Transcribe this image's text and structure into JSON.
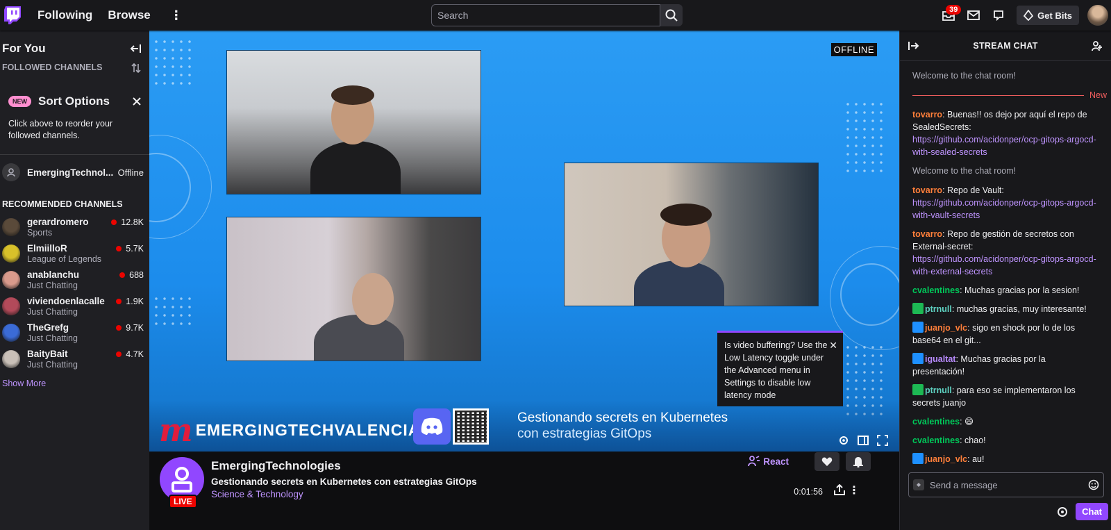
{
  "nav": {
    "following": "Following",
    "browse": "Browse",
    "search_placeholder": "Search",
    "notifications_count": "39",
    "get_bits": "Get Bits"
  },
  "sidebar": {
    "title": "For You",
    "followed_label": "FOLLOWED CHANNELS",
    "sort": {
      "badge": "NEW",
      "title": "Sort Options",
      "description": "Click above to reorder your followed channels."
    },
    "followed": [
      {
        "name": "EmergingTechnol...",
        "status": "Offline"
      }
    ],
    "recommended_label": "RECOMMENDED CHANNELS",
    "recommended": [
      {
        "name": "gerardromero",
        "category": "Sports",
        "viewers": "12.8K",
        "color": "#5a4a3a"
      },
      {
        "name": "ElmiilloR",
        "category": "League of Legends",
        "viewers": "5.7K",
        "color": "#d8c12a"
      },
      {
        "name": "anablanchu",
        "category": "Just Chatting",
        "viewers": "688",
        "color": "#d99a8c"
      },
      {
        "name": "viviendoenlacalle",
        "category": "Just Chatting",
        "viewers": "1.9K",
        "color": "#b34a5a"
      },
      {
        "name": "TheGrefg",
        "category": "Just Chatting",
        "viewers": "9.7K",
        "color": "#3b6bd6"
      },
      {
        "name": "BaityBait",
        "category": "Just Chatting",
        "viewers": "4.7K",
        "color": "#c9c0b8"
      }
    ],
    "show_more": "Show More"
  },
  "player": {
    "offline": "OFFLINE",
    "brand": "EMERGINGTECHVALENCIA",
    "overlay_line1": "Gestionando secrets en Kubernetes",
    "overlay_line2": "con estrategias GitOps",
    "buffer_tip": "Is video buffering? Use the Low Latency toggle under the Advanced menu in Settings to disable low latency mode"
  },
  "channel": {
    "name": "EmergingTechnologies",
    "stream_title": "Gestionando secrets en Kubernetes con estrategias GitOps",
    "category": "Science & Technology",
    "live": "LIVE",
    "react": "React",
    "uptime": "0:01:56"
  },
  "chat": {
    "title": "STREAM CHAT",
    "welcome": "Welcome to the chat room!",
    "new_label": "New",
    "input_placeholder": "Send a message",
    "chat_button": "Chat",
    "messages": [
      {
        "user": "tovarro",
        "color": "#ff7f3a",
        "badge": "",
        "text": " Buenas!! os dejo por aquí el repo de SealedSecrets: ",
        "link": "https://github.com/acidonper/ocp-gitops-argocd-with-sealed-secrets"
      },
      {
        "system": "Welcome to the chat room!"
      },
      {
        "user": "tovarro",
        "color": "#ff7f3a",
        "badge": "",
        "text": " Repo de Vault: ",
        "link": "https://github.com/acidonper/ocp-gitops-argocd-with-vault-secrets"
      },
      {
        "user": "tovarro",
        "color": "#ff7f3a",
        "badge": "",
        "text": " Repo de gestión de secretos con External-secret: ",
        "link": "https://github.com/acidonper/ocp-gitops-argocd-with-external-secrets"
      },
      {
        "user": "cvalentines",
        "color": "#00c95a",
        "badge": "",
        "text": " Muchas gracias por la sesion!",
        "link": ""
      },
      {
        "user": "ptrnull",
        "color": "#5fd3c3",
        "badge": "#1db954",
        "text": " muchas gracias, muy interesante!",
        "link": ""
      },
      {
        "user": "juanjo_vlc",
        "color": "#ff7f3a",
        "badge": "#1e90ff",
        "text": " sigo en shock por lo de los base64 en el git...",
        "link": ""
      },
      {
        "user": "igualtat",
        "color": "#b98bff",
        "badge": "#1e90ff",
        "text": " Muchas gracias por la presentación!",
        "link": ""
      },
      {
        "user": "ptrnull",
        "color": "#5fd3c3",
        "badge": "#1db954",
        "text": " para eso se implementaron los secrets juanjo",
        "link": ""
      },
      {
        "user": "cvalentines",
        "color": "#00c95a",
        "badge": "",
        "text": " 😄",
        "link": ""
      },
      {
        "user": "cvalentines",
        "color": "#00c95a",
        "badge": "",
        "text": " chao!",
        "link": ""
      },
      {
        "user": "juanjo_vlc",
        "color": "#ff7f3a",
        "badge": "#1e90ff",
        "text": " au!",
        "link": ""
      }
    ]
  }
}
